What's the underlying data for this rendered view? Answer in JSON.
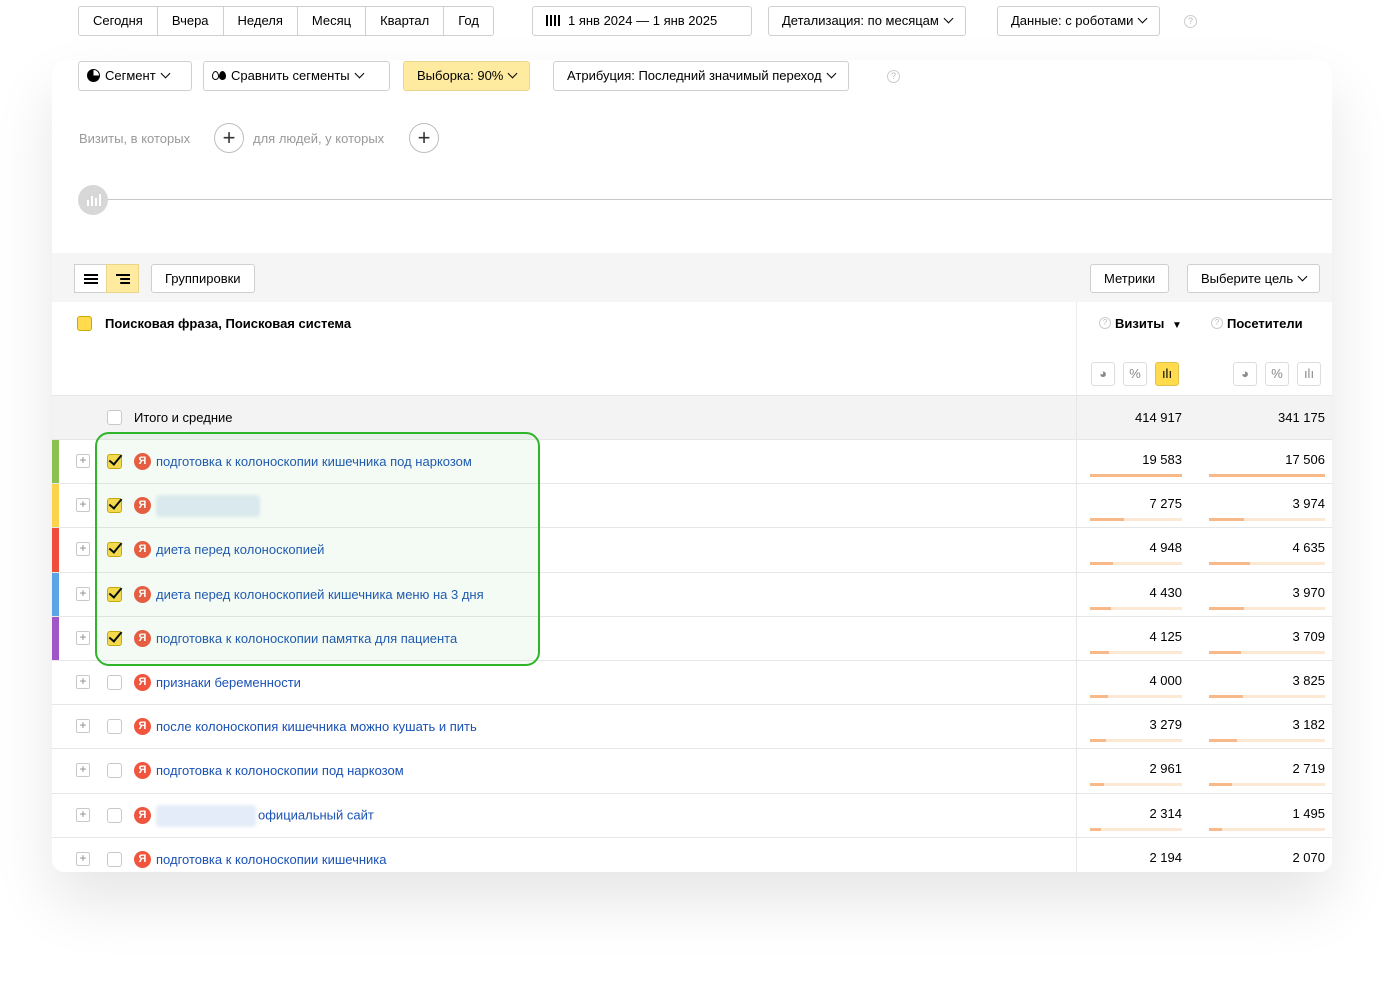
{
  "periods": [
    "Сегодня",
    "Вчера",
    "Неделя",
    "Месяц",
    "Квартал",
    "Год"
  ],
  "date_range": "1 янв 2024 — 1 янв 2025",
  "detail": "Детализация: по месяцам",
  "data_mode": "Данные: с роботами",
  "segment": "Сегмент",
  "compare_segments": "Сравнить сегменты",
  "sample": "Выборка: 90%",
  "attribution": "Атрибуция: Последний значимый переход",
  "filter": {
    "visits_text": "Визиты, в которых",
    "people_text": "для людей, у которых"
  },
  "toolbar": {
    "groupings": "Группировки",
    "metrics": "Метрики",
    "goal": "Выберите цель"
  },
  "header": {
    "dimension": "Поисковая фраза, Поисковая система",
    "visits": "Визиты",
    "visitors": "Посетители"
  },
  "totals": {
    "label": "Итого и средние",
    "visits": "414 917",
    "visitors": "341 175"
  },
  "rows": [
    {
      "phrase": "подготовка к колоноскопии кишечника под наркозом",
      "visits": "19 583",
      "visitors": "17 506",
      "checked": true,
      "color": "#8cc152",
      "visits_share": 1.0,
      "visitors_share": 1.0
    },
    {
      "phrase": "",
      "visits": "7 275",
      "visitors": "3 974",
      "checked": true,
      "color": "#fcd34d",
      "visits_share": 0.37,
      "visitors_share": 0.3
    },
    {
      "phrase": "диета перед колоноскопией",
      "visits": "4 948",
      "visitors": "4 635",
      "checked": true,
      "color": "#ef4e3a",
      "visits_share": 0.25,
      "visitors_share": 0.35
    },
    {
      "phrase": "диета перед колоноскопией кишечника меню на 3 дня",
      "visits": "4 430",
      "visitors": "3 970",
      "checked": true,
      "color": "#5ba4e5",
      "visits_share": 0.23,
      "visitors_share": 0.3
    },
    {
      "phrase": "подготовка к колоноскопии памятка для пациента",
      "visits": "4 125",
      "visitors": "3 709",
      "checked": true,
      "color": "#a056c7",
      "visits_share": 0.21,
      "visitors_share": 0.28
    },
    {
      "phrase": "признаки беременности",
      "visits": "4 000",
      "visitors": "3 825",
      "checked": false,
      "color": "",
      "visits_share": 0.2,
      "visitors_share": 0.29
    },
    {
      "phrase": "после колоноскопия кишечника можно кушать и пить",
      "visits": "3 279",
      "visitors": "3 182",
      "checked": false,
      "color": "",
      "visits_share": 0.17,
      "visitors_share": 0.24
    },
    {
      "phrase": "подготовка к колоноскопии под наркозом",
      "visits": "2 961",
      "visitors": "2 719",
      "checked": false,
      "color": "",
      "visits_share": 0.15,
      "visitors_share": 0.2
    },
    {
      "phrase": "официальный сайт",
      "visits": "2 314",
      "visitors": "1 495",
      "checked": false,
      "color": "",
      "visits_share": 0.12,
      "visitors_share": 0.11
    },
    {
      "phrase": "подготовка к колоноскопии кишечника",
      "visits": "2 194",
      "visitors": "2 070",
      "checked": false,
      "color": "",
      "visits_share": 0.11,
      "visitors_share": 0.16
    }
  ]
}
